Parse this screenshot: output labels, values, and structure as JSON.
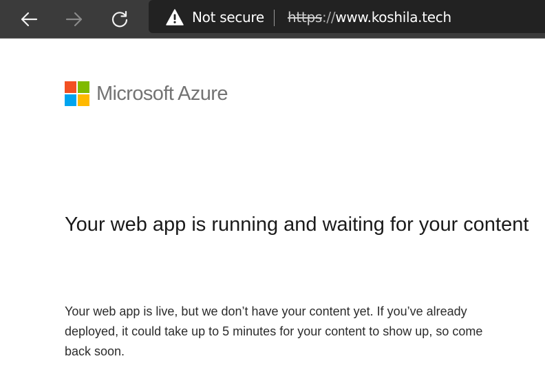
{
  "browser": {
    "security_label": "Not secure",
    "url_scheme": "https",
    "url_separator": "://",
    "url_host": "www.koshila.tech",
    "icons": {
      "back": "back-arrow-icon",
      "forward": "forward-arrow-icon",
      "refresh": "refresh-icon",
      "warning": "warning-icon"
    },
    "colors": {
      "toolbar": "#3b3b3b",
      "address_bar": "#222222"
    }
  },
  "page": {
    "brand": "Microsoft Azure",
    "brand_colors": [
      "#f25022",
      "#7fba00",
      "#00a4ef",
      "#ffb900"
    ],
    "headline": "Your web app is running and waiting for your content",
    "body": "Your web app is live, but we don’t have your content yet. If you’ve already deployed, it could take up to 5 minutes for your content to show up, so come back soon."
  }
}
